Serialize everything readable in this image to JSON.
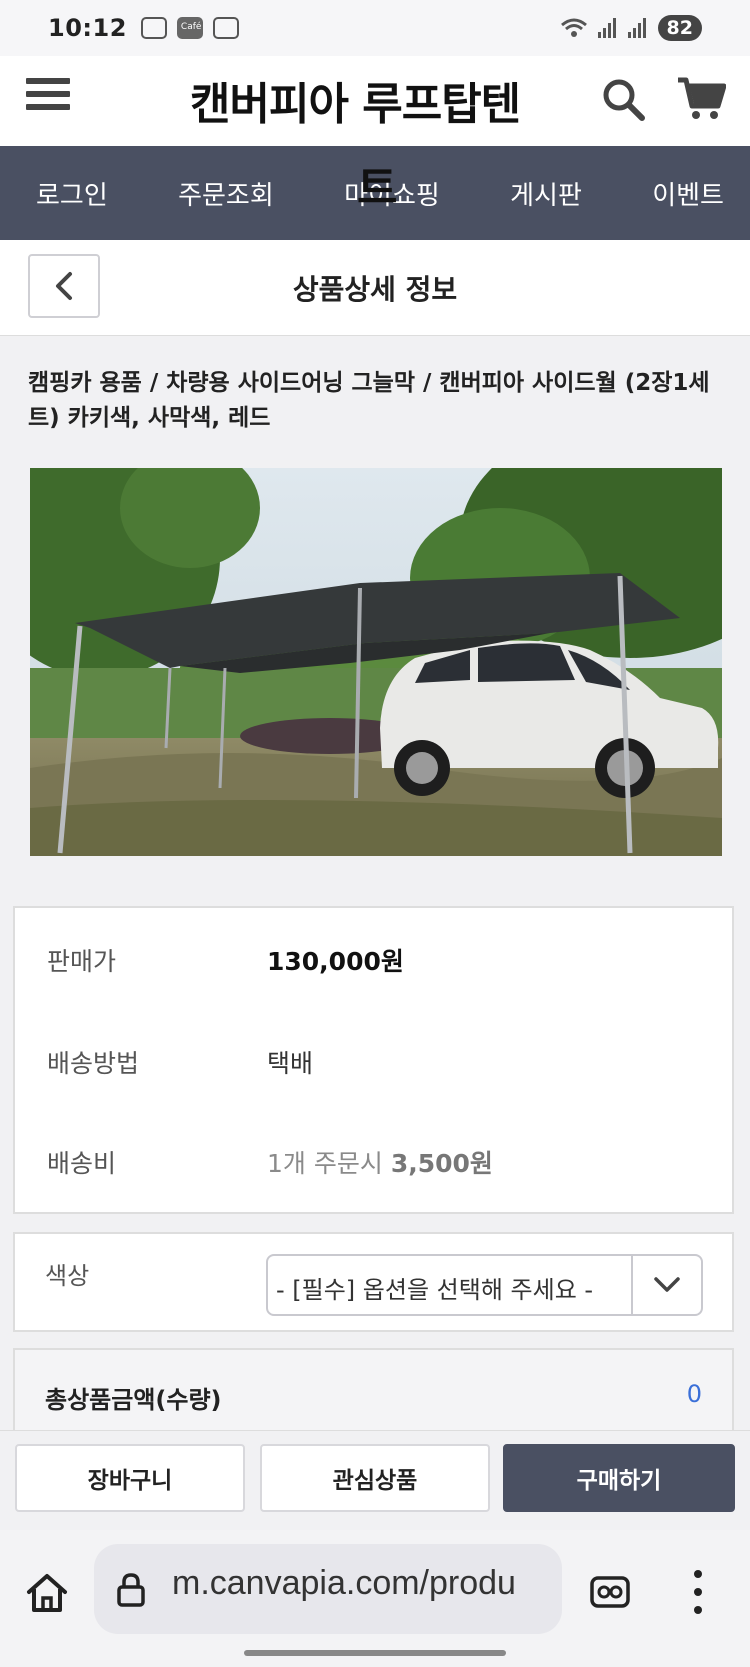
{
  "status_bar": {
    "time": "10:12",
    "battery": "82"
  },
  "header": {
    "brand": "캔버피아 루프탑텐"
  },
  "nav": {
    "items": [
      "로그인",
      "주문조회",
      "마이쇼핑",
      "게시판",
      "이벤트"
    ],
    "overlay_char": "트"
  },
  "title_bar": {
    "title": "상품상세 정보"
  },
  "product": {
    "name": "캠핑카 용품 / 차량용 사이드어닝 그늘막 / 캔버피아 사이드월 (2장1세트) 카키색, 사막색, 레드"
  },
  "info": {
    "price_label": "판매가",
    "price_value": "130,000원",
    "shipping_method_label": "배송방법",
    "shipping_method_value": "택배",
    "shipping_fee_label": "배송비",
    "shipping_fee_prefix": "1개 주문시 ",
    "shipping_fee_amount": "3,500원"
  },
  "option": {
    "label": "색상",
    "selected": "- [필수] 옵션을 선택해 주세요 -"
  },
  "total": {
    "label": "총상품금액(수량)",
    "count": "0"
  },
  "actions": {
    "cart": "장바구니",
    "wish": "관심상품",
    "buy": "구매하기"
  },
  "browser": {
    "url": "m.canvapia.com/produ"
  },
  "icons": [
    "hamburger-icon",
    "search-icon",
    "cart-icon",
    "back-icon",
    "chevron-down-icon",
    "home-icon",
    "lock-icon",
    "reader-mode-icon",
    "more-vert-icon"
  ]
}
